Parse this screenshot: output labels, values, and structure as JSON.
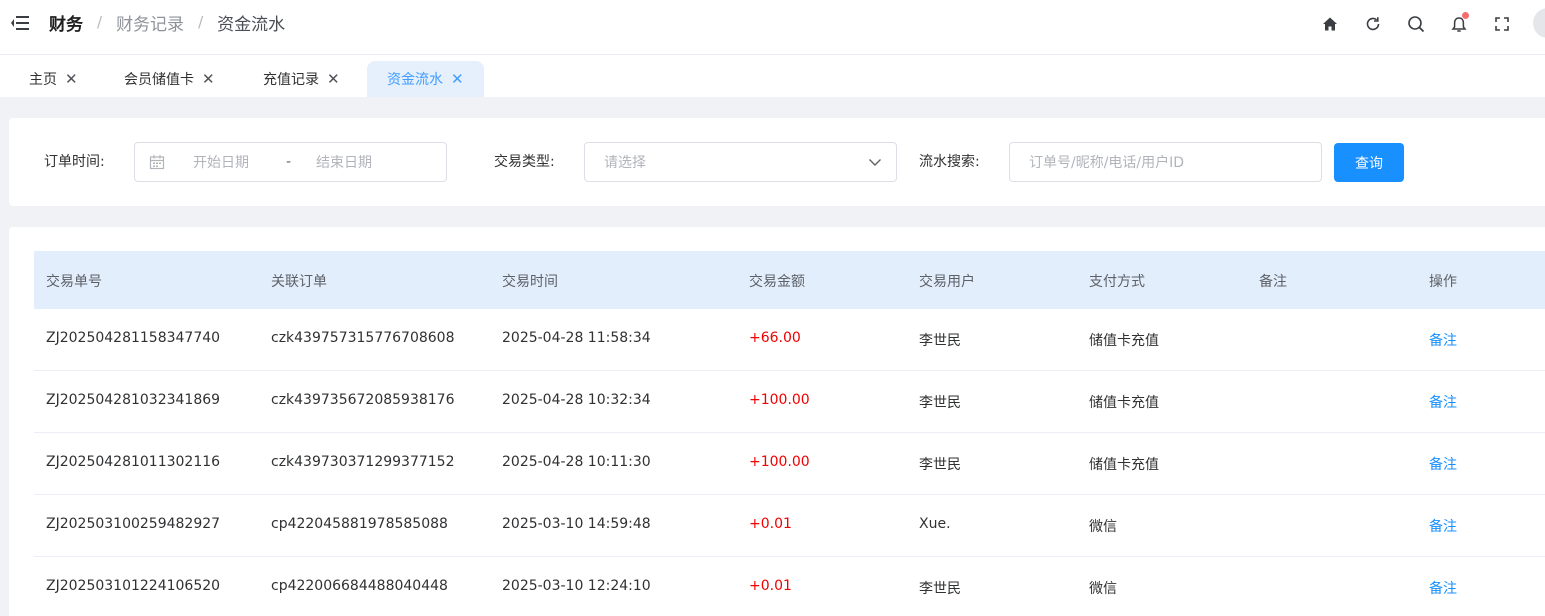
{
  "header": {
    "breadcrumb": [
      "财务",
      "财务记录",
      "资金流水"
    ],
    "separator": "/"
  },
  "tabs": [
    {
      "label": "主页",
      "active": false
    },
    {
      "label": "会员储值卡",
      "active": false
    },
    {
      "label": "充值记录",
      "active": false
    },
    {
      "label": "资金流水",
      "active": true
    }
  ],
  "filter": {
    "order_time_label": "订单时间:",
    "start_placeholder": "开始日期",
    "range_separator": "-",
    "end_placeholder": "结束日期",
    "type_label": "交易类型:",
    "type_placeholder": "请选择",
    "search_label": "流水搜索:",
    "search_placeholder": "订单号/昵称/电话/用户ID",
    "query_button": "查询"
  },
  "table": {
    "columns": [
      "交易单号",
      "关联订单",
      "交易时间",
      "交易金额",
      "交易用户",
      "支付方式",
      "备注",
      "操作"
    ],
    "rows": [
      {
        "no": "ZJ202504281158347740",
        "order": "czk439757315776708608",
        "time": "2025-04-28 11:58:34",
        "amount": "+66.00",
        "user": "李世民",
        "pay": "储值卡充值",
        "note": "",
        "action": "备注"
      },
      {
        "no": "ZJ202504281032341869",
        "order": "czk439735672085938176",
        "time": "2025-04-28 10:32:34",
        "amount": "+100.00",
        "user": "李世民",
        "pay": "储值卡充值",
        "note": "",
        "action": "备注"
      },
      {
        "no": "ZJ202504281011302116",
        "order": "czk439730371299377152",
        "time": "2025-04-28 10:11:30",
        "amount": "+100.00",
        "user": "李世民",
        "pay": "储值卡充值",
        "note": "",
        "action": "备注"
      },
      {
        "no": "ZJ202503100259482927",
        "order": "cp422045881978585088",
        "time": "2025-03-10 14:59:48",
        "amount": "+0.01",
        "user": "Xue.",
        "pay": "微信",
        "note": "",
        "action": "备注"
      },
      {
        "no": "ZJ202503101224106520",
        "order": "cp422006684488040448",
        "time": "2025-03-10 12:24:10",
        "amount": "+0.01",
        "user": "李世民",
        "pay": "微信",
        "note": "",
        "action": "备注"
      }
    ]
  },
  "colors": {
    "accent": "#1890ff",
    "amount_positive": "#f00000",
    "header_row_bg": "#e3eefd"
  }
}
